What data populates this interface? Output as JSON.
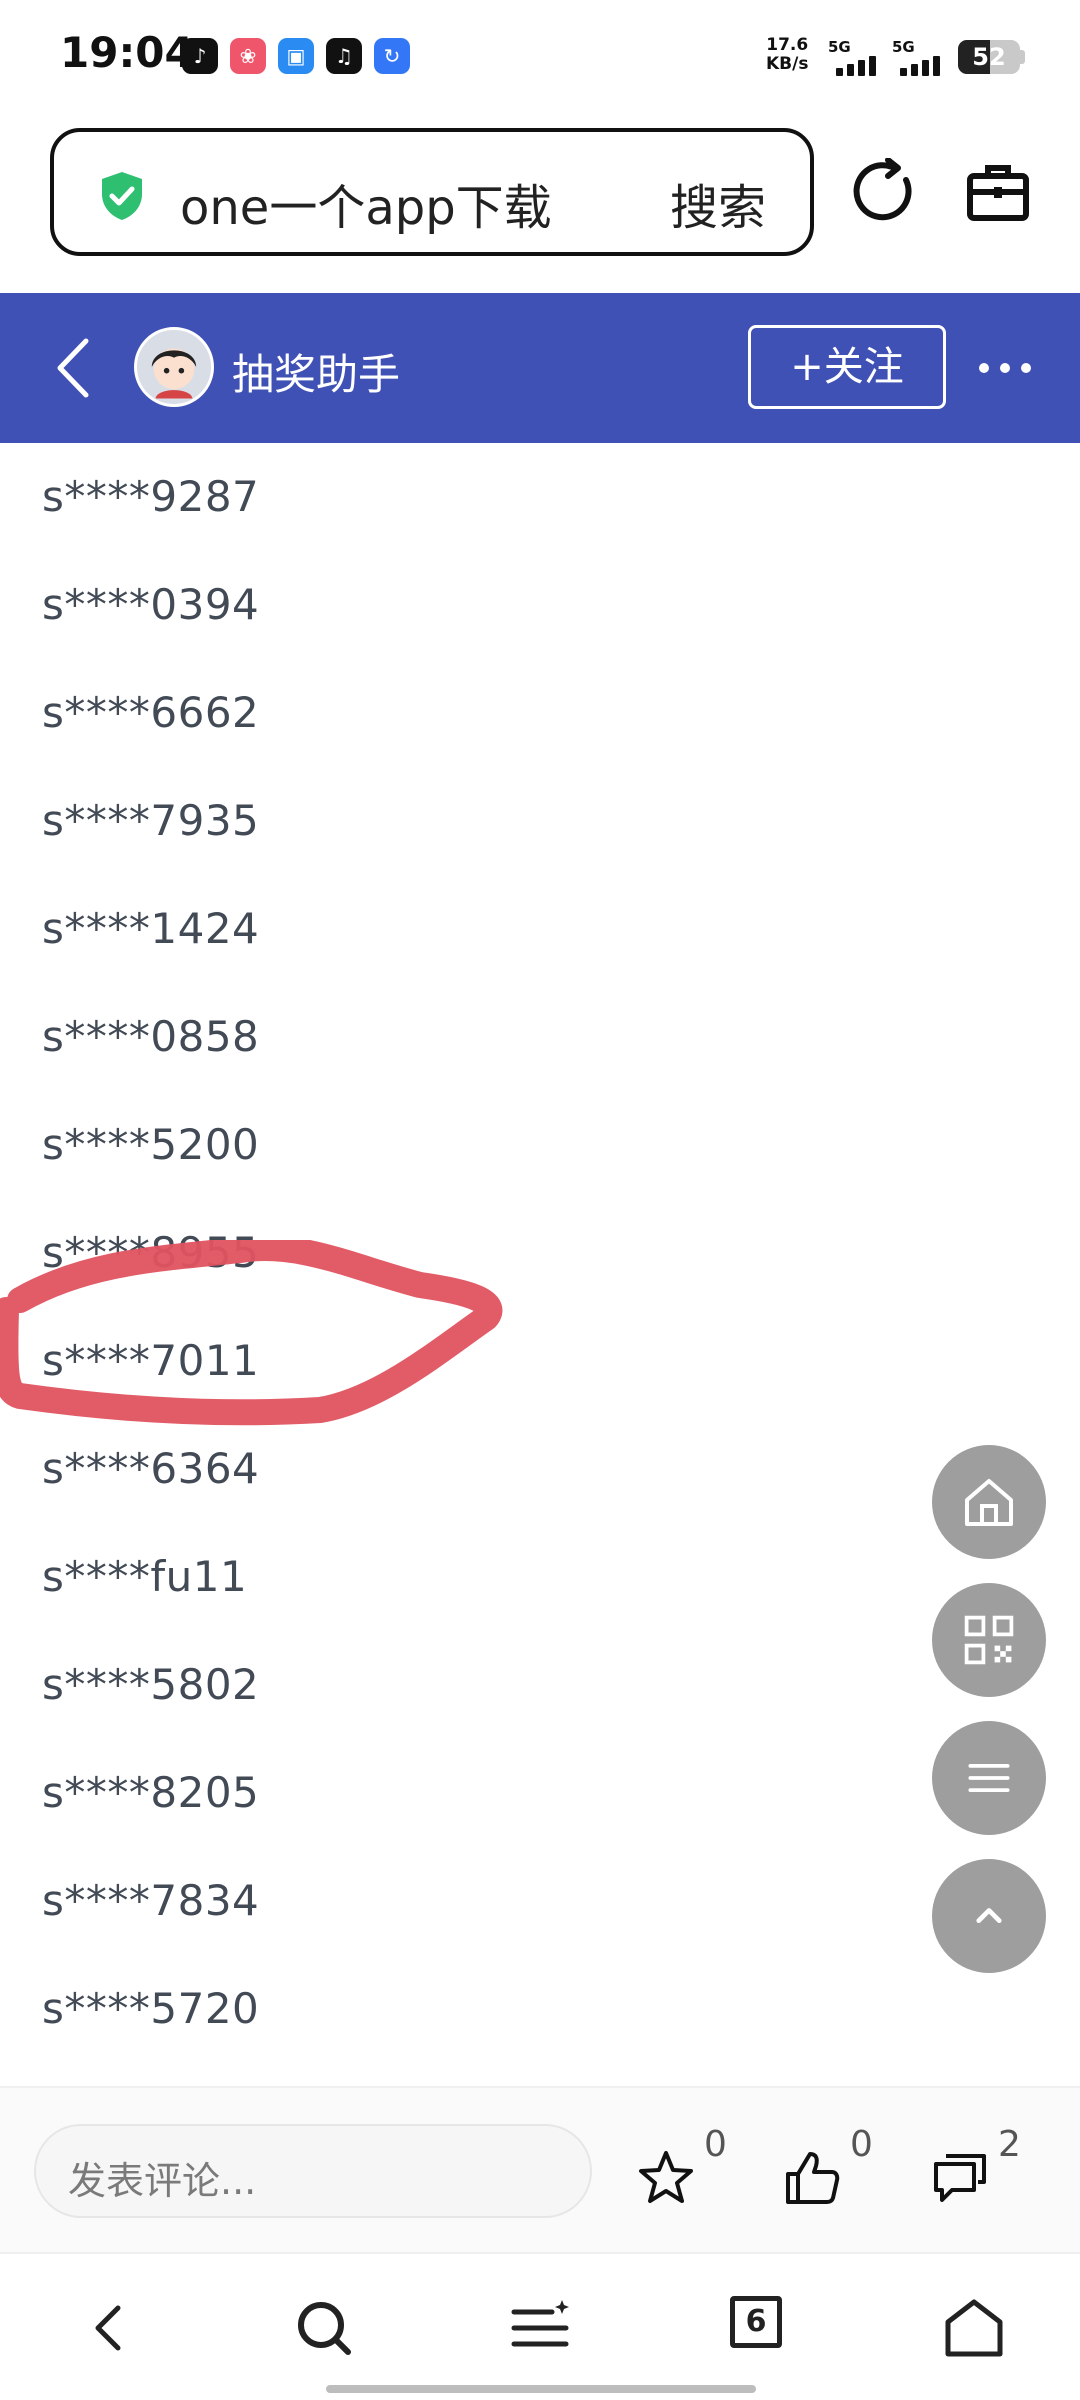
{
  "status_bar": {
    "time": "19:04",
    "net_speed_value": "17.6",
    "net_speed_unit": "KB/s",
    "sim1_label": "5G",
    "sim2_label": "5G",
    "battery": "52",
    "notification_icons": [
      "douyin-icon",
      "pinduoduo-icon",
      "app-icon",
      "music-icon",
      "browser-icon"
    ]
  },
  "browser": {
    "search_query": "one一个app下载",
    "search_button": "搜索"
  },
  "header": {
    "account_name": "抽奖助手",
    "follow_label": "+关注",
    "color": "#3f51b5"
  },
  "winners": [
    "s****9287",
    "s****0394",
    "s****6662",
    "s****7935",
    "s****1424",
    "s****0858",
    "s****5200",
    "s****8955",
    "s****7011",
    "s****6364",
    "s****fu11",
    "s****5802",
    "s****8205",
    "s****7834",
    "s****5720"
  ],
  "floating_buttons": [
    "home-icon",
    "qr-code-icon",
    "menu-icon",
    "scroll-top-icon"
  ],
  "comment_bar": {
    "placeholder": "发表评论...",
    "favorite_count": "0",
    "like_count": "0",
    "comment_count": "2"
  },
  "nav_bar": {
    "tab_count": "6"
  },
  "colors": {
    "highlight_scribble": "#e05360",
    "fab_gray": "#9e9e9e",
    "shield_green": "#2fbf71"
  }
}
